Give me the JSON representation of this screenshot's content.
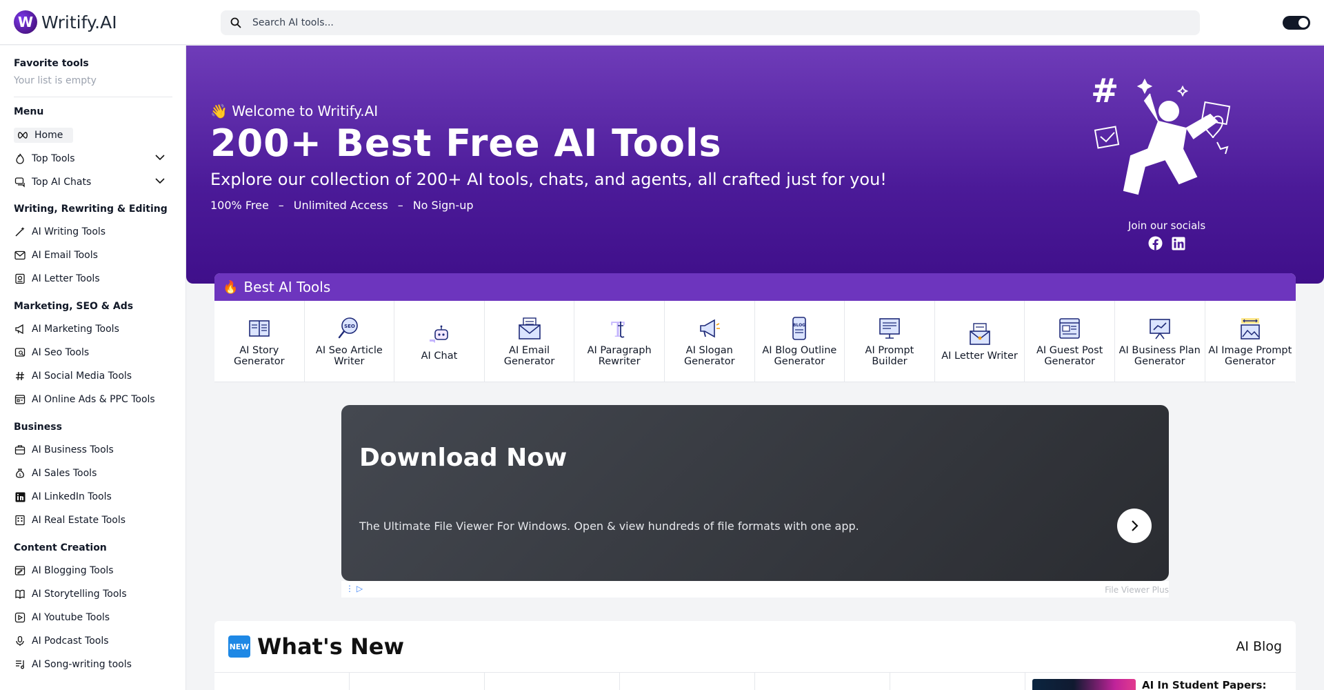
{
  "header": {
    "brand": "Writify.AI",
    "logo_letter": "W",
    "search_placeholder": "Search AI tools..."
  },
  "sidebar": {
    "favorites_title": "Favorite tools",
    "favorites_empty": "Your list is empty",
    "menu_title": "Menu",
    "menu_items": [
      {
        "label": "Home",
        "icon": "infinity-icon"
      },
      {
        "label": "Top Tools",
        "icon": "flame-icon"
      },
      {
        "label": "Top AI Chats",
        "icon": "chat-icon"
      }
    ],
    "sections": [
      {
        "title": "Writing, Rewriting & Editing",
        "items": [
          "AI Writing Tools",
          "AI Email Tools",
          "AI Letter Tools"
        ]
      },
      {
        "title": "Marketing, SEO & Ads",
        "items": [
          "AI Marketing Tools",
          "AI Seo Tools",
          "AI Social Media Tools",
          "AI Online Ads & PPC Tools"
        ]
      },
      {
        "title": "Business",
        "items": [
          "AI Business Tools",
          "AI Sales Tools",
          "AI LinkedIn Tools",
          "AI Real Estate Tools"
        ]
      },
      {
        "title": "Content Creation",
        "items": [
          "AI Blogging Tools",
          "AI Storytelling Tools",
          "AI Youtube Tools",
          "AI Podcast Tools",
          "AI Song-writing tools"
        ]
      }
    ]
  },
  "hero": {
    "welcome_emoji": "👋",
    "welcome": "Welcome to Writify.AI",
    "title": "200+ Best Free AI Tools",
    "subtitle": "Explore our collection of 200+ AI tools, chats, and agents, all crafted just for you!",
    "tags": [
      "100% Free",
      "–",
      "Unlimited Access",
      "–",
      "No Sign-up"
    ],
    "socials_label": "Join our socials",
    "socials": [
      "facebook-icon",
      "linkedin-icon"
    ]
  },
  "best_tools": {
    "title": "Best AI Tools",
    "tools": [
      {
        "label": "AI Story Generator",
        "icon": "book-icon"
      },
      {
        "label": "AI Seo Article Writer",
        "icon": "seo-magnifier-icon"
      },
      {
        "label": "AI Chat",
        "icon": "robot-chat-icon"
      },
      {
        "label": "AI Email Generator",
        "icon": "envelope-icon"
      },
      {
        "label": "AI Paragraph Rewriter",
        "icon": "text-cursor-icon"
      },
      {
        "label": "AI Slogan Generator",
        "icon": "megaphone-icon"
      },
      {
        "label": "AI Blog Outline Generator",
        "icon": "blog-phone-icon"
      },
      {
        "label": "AI Prompt Builder",
        "icon": "monitor-icon"
      },
      {
        "label": "AI Letter Writer",
        "icon": "letter-icon"
      },
      {
        "label": "AI Guest Post Generator",
        "icon": "browser-card-icon"
      },
      {
        "label": "AI Business Plan Generator",
        "icon": "presentation-icon"
      },
      {
        "label": "AI Image Prompt Generator",
        "icon": "image-resize-icon"
      }
    ]
  },
  "ad": {
    "title": "Download Now",
    "text": "The Ultimate File Viewer For Windows. Open & view hundreds of file formats with one app.",
    "advertiser": "File Viewer Plus"
  },
  "whats_new": {
    "badge": "NEW",
    "title": "What's New",
    "blog_link": "AI Blog",
    "blog_post_title": "AI In Student Papers:"
  },
  "colors": {
    "brand_purple": "#6d35be",
    "hero_top": "#6f3cb9",
    "hero_bottom": "#3f0f8a",
    "ad_bg": "#2a2c31"
  }
}
